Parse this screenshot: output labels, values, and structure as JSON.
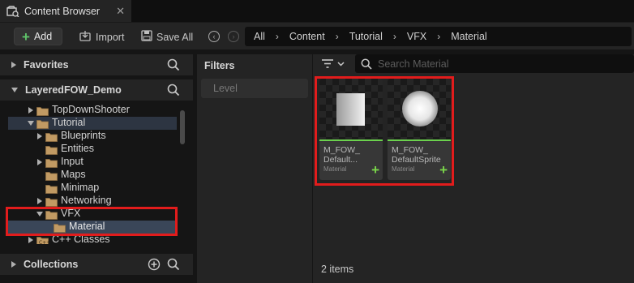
{
  "tab": {
    "title": "Content Browser",
    "close": "✕"
  },
  "toolbar": {
    "add_label": "Add",
    "import_label": "Import",
    "save_all_label": "Save All"
  },
  "breadcrumb": [
    "All",
    "Content",
    "Tutorial",
    "VFX",
    "Material"
  ],
  "left": {
    "favorites_label": "Favorites",
    "project_label": "LayeredFOW_Demo",
    "collections_label": "Collections",
    "tree": [
      {
        "name": "TopDownShooter",
        "level": 1,
        "expand": "collapsed"
      },
      {
        "name": "Tutorial",
        "level": 1,
        "expand": "expanded"
      },
      {
        "name": "Blueprints",
        "level": 2,
        "expand": "collapsed"
      },
      {
        "name": "Entities",
        "level": 2,
        "expand": "none"
      },
      {
        "name": "Input",
        "level": 2,
        "expand": "collapsed"
      },
      {
        "name": "Maps",
        "level": 2,
        "expand": "none"
      },
      {
        "name": "Minimap",
        "level": 2,
        "expand": "none"
      },
      {
        "name": "Networking",
        "level": 2,
        "expand": "collapsed"
      },
      {
        "name": "VFX",
        "level": 2,
        "expand": "expanded"
      },
      {
        "name": "Material",
        "level": 3,
        "expand": "none"
      },
      {
        "name": "C++ Classes",
        "level": 1,
        "expand": "collapsed"
      }
    ]
  },
  "filters": {
    "title": "Filters",
    "level_label": "Level"
  },
  "content": {
    "search_placeholder": "Search Material",
    "assets": [
      {
        "name_line1": "M_FOW_",
        "name_line2": "Default...",
        "type": "Material",
        "thumb": "square"
      },
      {
        "name_line1": "M_FOW_",
        "name_line2": "DefaultSprite",
        "type": "Material",
        "thumb": "sphere"
      }
    ],
    "item_count": "2 items"
  },
  "colors": {
    "highlight": "#e21c1c",
    "accent_green": "#6bd14d",
    "selection": "#3a4658"
  }
}
